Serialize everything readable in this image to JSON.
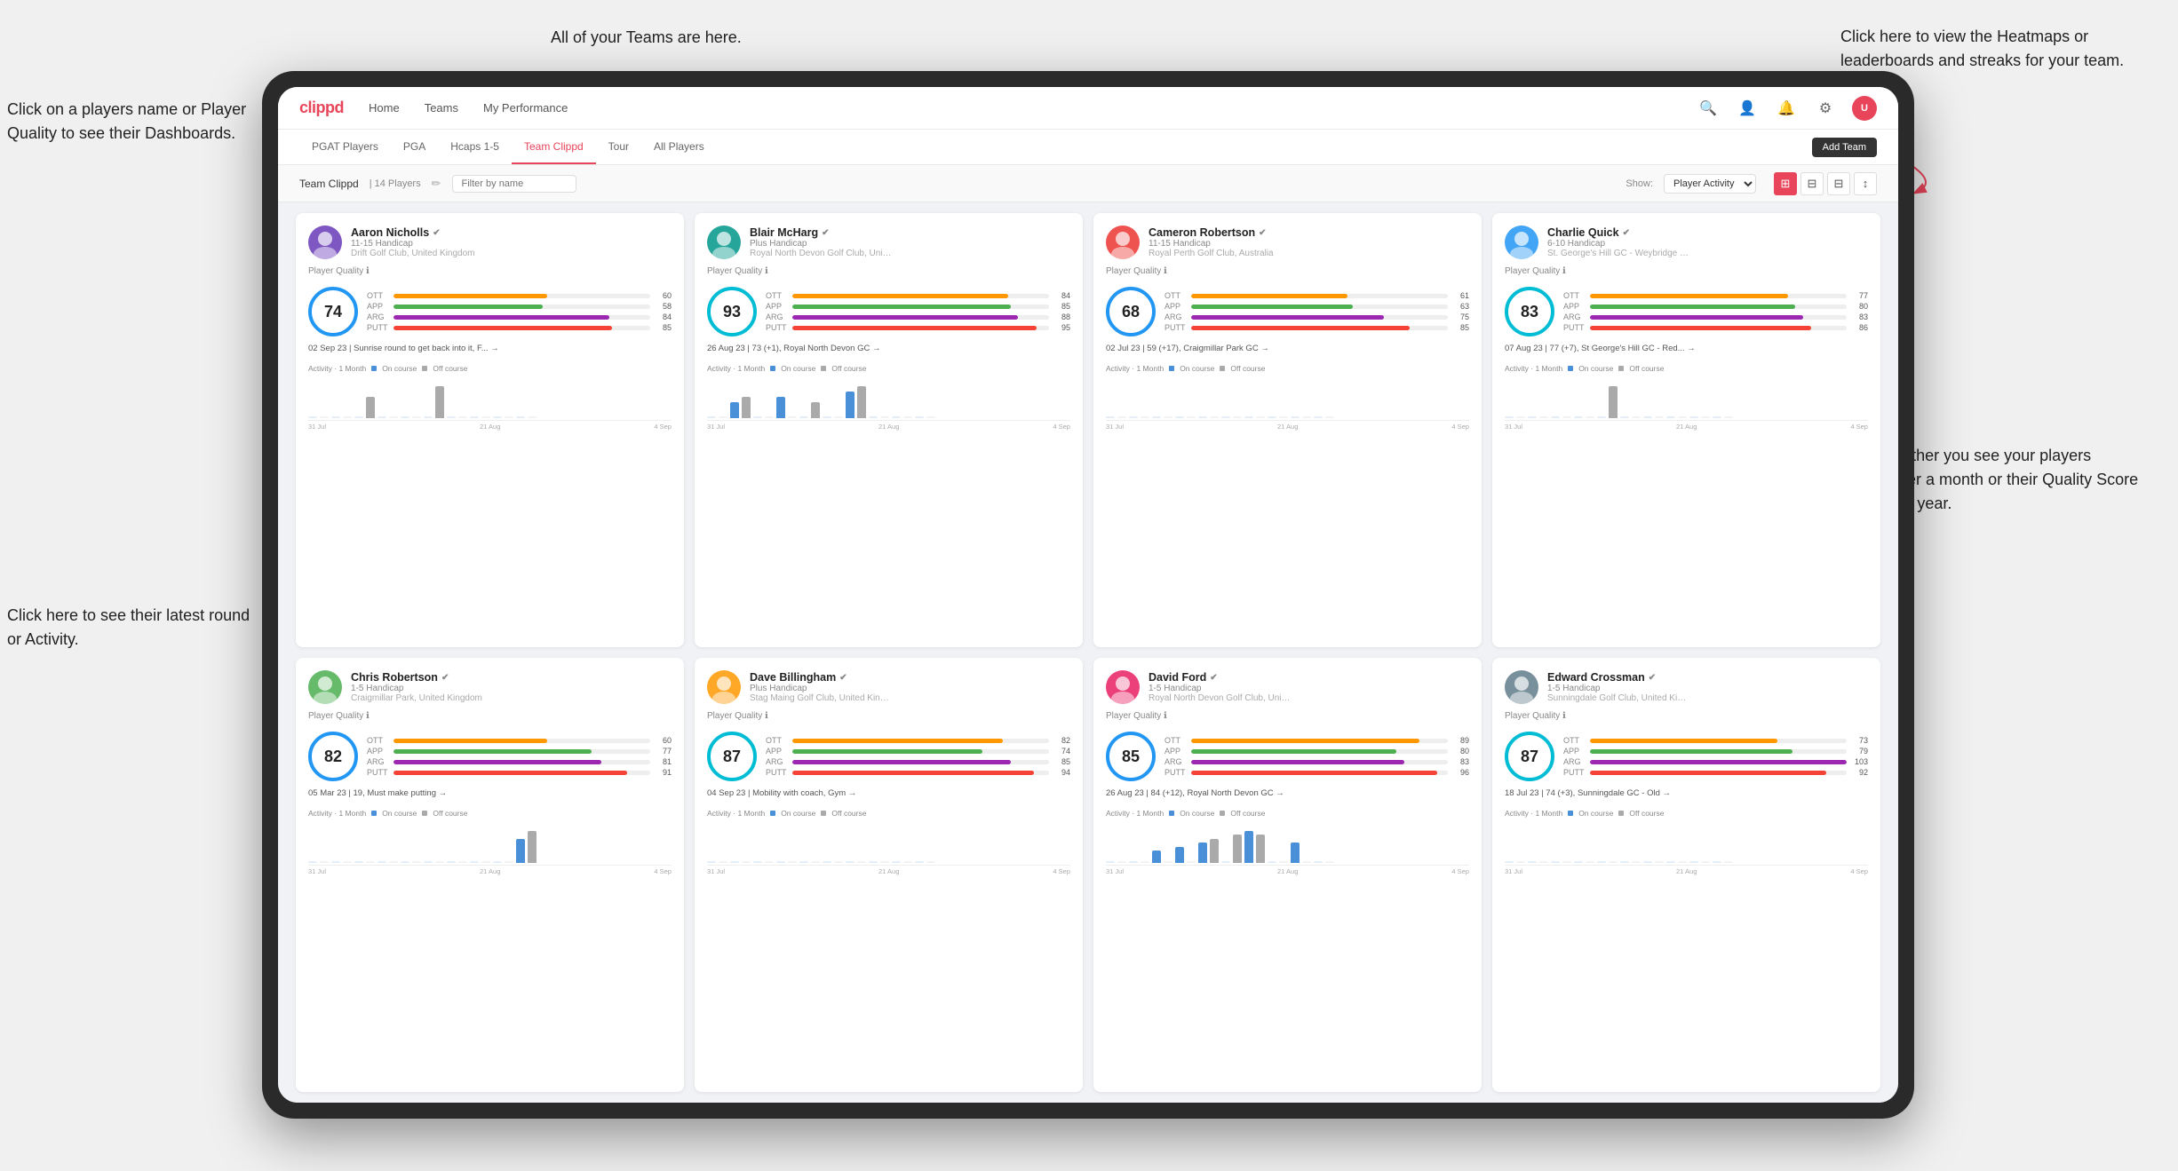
{
  "app": {
    "logo": "clippd",
    "nav": {
      "items": [
        "Home",
        "Teams",
        "My Performance"
      ]
    },
    "sub_nav": {
      "items": [
        "PGAT Players",
        "PGA",
        "Hcaps 1-5",
        "Team Clippd",
        "Tour",
        "All Players"
      ],
      "active": "Team Clippd"
    },
    "add_team_label": "Add Team",
    "team_header": {
      "title": "Team Clippd",
      "count": "14 Players",
      "search_placeholder": "Filter by name",
      "show_label": "Show:",
      "show_value": "Player Activity"
    }
  },
  "annotations": {
    "teams": "All of your Teams are here.",
    "heatmaps": "Click here to view the\nHeatmaps or leaderboards\nand streaks for your team.",
    "player_name": "Click on a players name\nor Player Quality to see\ntheir Dashboards.",
    "activities": "Choose whether you see\nyour players Activities over\na month or their Quality\nScore Trend over a year.",
    "latest_round": "Click here to see their latest\nround or Activity."
  },
  "players": [
    {
      "name": "Aaron Nicholls",
      "handicap": "11-15 Handicap",
      "club": "Drift Golf Club, United Kingdom",
      "quality": 74,
      "ott": {
        "val": 60,
        "pct": 60
      },
      "app": {
        "val": 58,
        "pct": 58
      },
      "arg": {
        "val": 84,
        "pct": 84
      },
      "putt": {
        "val": 85,
        "pct": 85
      },
      "latest": "02 Sep 23 | Sunrise round to get back into it, F... →",
      "chart_bars": [
        0,
        0,
        0,
        0,
        0,
        2,
        0,
        0,
        0,
        0,
        0,
        3,
        0,
        0,
        0,
        0,
        0,
        0,
        0,
        0
      ],
      "dates": [
        "31 Jul",
        "21 Aug",
        "4 Sep"
      ]
    },
    {
      "name": "Blair McHarg",
      "handicap": "Plus Handicap",
      "club": "Royal North Devon Golf Club, United Ki...",
      "quality": 93,
      "ott": {
        "val": 84,
        "pct": 84
      },
      "app": {
        "val": 85,
        "pct": 85
      },
      "arg": {
        "val": 88,
        "pct": 88
      },
      "putt": {
        "val": 95,
        "pct": 95
      },
      "latest": "26 Aug 23 | 73 (+1), Royal North Devon GC →",
      "chart_bars": [
        0,
        0,
        3,
        4,
        0,
        0,
        4,
        0,
        0,
        3,
        0,
        0,
        5,
        6,
        0,
        0,
        0,
        0,
        0,
        0
      ],
      "dates": [
        "31 Jul",
        "21 Aug",
        "4 Sep"
      ]
    },
    {
      "name": "Cameron Robertson",
      "handicap": "11-15 Handicap",
      "club": "Royal Perth Golf Club, Australia",
      "quality": 68,
      "ott": {
        "val": 61,
        "pct": 61
      },
      "app": {
        "val": 63,
        "pct": 63
      },
      "arg": {
        "val": 75,
        "pct": 75
      },
      "putt": {
        "val": 85,
        "pct": 85
      },
      "latest": "02 Jul 23 | 59 (+17), Craigmillar Park GC →",
      "chart_bars": [
        0,
        0,
        0,
        0,
        0,
        0,
        0,
        0,
        0,
        0,
        0,
        0,
        0,
        0,
        0,
        0,
        0,
        0,
        0,
        0
      ],
      "dates": [
        "31 Jul",
        "21 Aug",
        "4 Sep"
      ]
    },
    {
      "name": "Charlie Quick",
      "handicap": "6-10 Handicap",
      "club": "St. George's Hill GC - Weybridge - Surrey...",
      "quality": 83,
      "ott": {
        "val": 77,
        "pct": 77
      },
      "app": {
        "val": 80,
        "pct": 80
      },
      "arg": {
        "val": 83,
        "pct": 83
      },
      "putt": {
        "val": 86,
        "pct": 86
      },
      "latest": "07 Aug 23 | 77 (+7), St George's Hill GC - Red... →",
      "chart_bars": [
        0,
        0,
        0,
        0,
        0,
        0,
        0,
        0,
        0,
        3,
        0,
        0,
        0,
        0,
        0,
        0,
        0,
        0,
        0,
        0
      ],
      "dates": [
        "31 Jul",
        "21 Aug",
        "4 Sep"
      ]
    },
    {
      "name": "Chris Robertson",
      "handicap": "1-5 Handicap",
      "club": "Craigmillar Park, United Kingdom",
      "quality": 82,
      "ott": {
        "val": 60,
        "pct": 60
      },
      "app": {
        "val": 77,
        "pct": 77
      },
      "arg": {
        "val": 81,
        "pct": 81
      },
      "putt": {
        "val": 91,
        "pct": 91
      },
      "latest": "05 Mar 23 | 19, Must make putting →",
      "chart_bars": [
        0,
        0,
        0,
        0,
        0,
        0,
        0,
        0,
        0,
        0,
        0,
        0,
        0,
        0,
        0,
        0,
        0,
        0,
        3,
        4
      ],
      "dates": [
        "31 Jul",
        "21 Aug",
        "4 Sep"
      ]
    },
    {
      "name": "Dave Billingham",
      "handicap": "Plus Handicap",
      "club": "Stag Maing Golf Club, United Kingdom",
      "quality": 87,
      "ott": {
        "val": 82,
        "pct": 82
      },
      "app": {
        "val": 74,
        "pct": 74
      },
      "arg": {
        "val": 85,
        "pct": 85
      },
      "putt": {
        "val": 94,
        "pct": 94
      },
      "latest": "04 Sep 23 | Mobility with coach, Gym →",
      "chart_bars": [
        0,
        0,
        0,
        0,
        0,
        0,
        0,
        0,
        0,
        0,
        0,
        0,
        0,
        0,
        0,
        0,
        0,
        0,
        0,
        0
      ],
      "dates": [
        "31 Jul",
        "21 Aug",
        "4 Sep"
      ]
    },
    {
      "name": "David Ford",
      "handicap": "1-5 Handicap",
      "club": "Royal North Devon Golf Club, United Kin...",
      "quality": 85,
      "ott": {
        "val": 89,
        "pct": 89
      },
      "app": {
        "val": 80,
        "pct": 80
      },
      "arg": {
        "val": 83,
        "pct": 83
      },
      "putt": {
        "val": 96,
        "pct": 96
      },
      "latest": "26 Aug 23 | 84 (+12), Royal North Devon GC →",
      "chart_bars": [
        0,
        0,
        0,
        0,
        3,
        0,
        4,
        0,
        5,
        6,
        0,
        7,
        8,
        7,
        0,
        0,
        5,
        0,
        0,
        0
      ],
      "dates": [
        "31 Jul",
        "21 Aug",
        "4 Sep"
      ]
    },
    {
      "name": "Edward Crossman",
      "handicap": "1-5 Handicap",
      "club": "Sunningdale Golf Club, United Kingdom",
      "quality": 87,
      "ott": {
        "val": 73,
        "pct": 73
      },
      "app": {
        "val": 79,
        "pct": 79
      },
      "arg": {
        "val": 103,
        "pct": 100
      },
      "putt": {
        "val": 92,
        "pct": 92
      },
      "latest": "18 Jul 23 | 74 (+3), Sunningdale GC - Old →",
      "chart_bars": [
        0,
        0,
        0,
        0,
        0,
        0,
        0,
        0,
        0,
        0,
        0,
        0,
        0,
        0,
        0,
        0,
        0,
        0,
        0,
        0
      ],
      "dates": [
        "31 Jul",
        "21 Aug",
        "4 Sep"
      ]
    }
  ],
  "chart": {
    "legend_on": "On course",
    "legend_off": "Off course",
    "period_label": "Activity · 1 Month"
  },
  "icons": {
    "search": "🔍",
    "user": "👤",
    "bell": "🔔",
    "settings": "⚙",
    "avatar_text": "U",
    "edit": "✏",
    "grid_view": "⊞",
    "list_view": "☰",
    "filter": "⊟",
    "sort": "↕",
    "verified": "✔"
  }
}
